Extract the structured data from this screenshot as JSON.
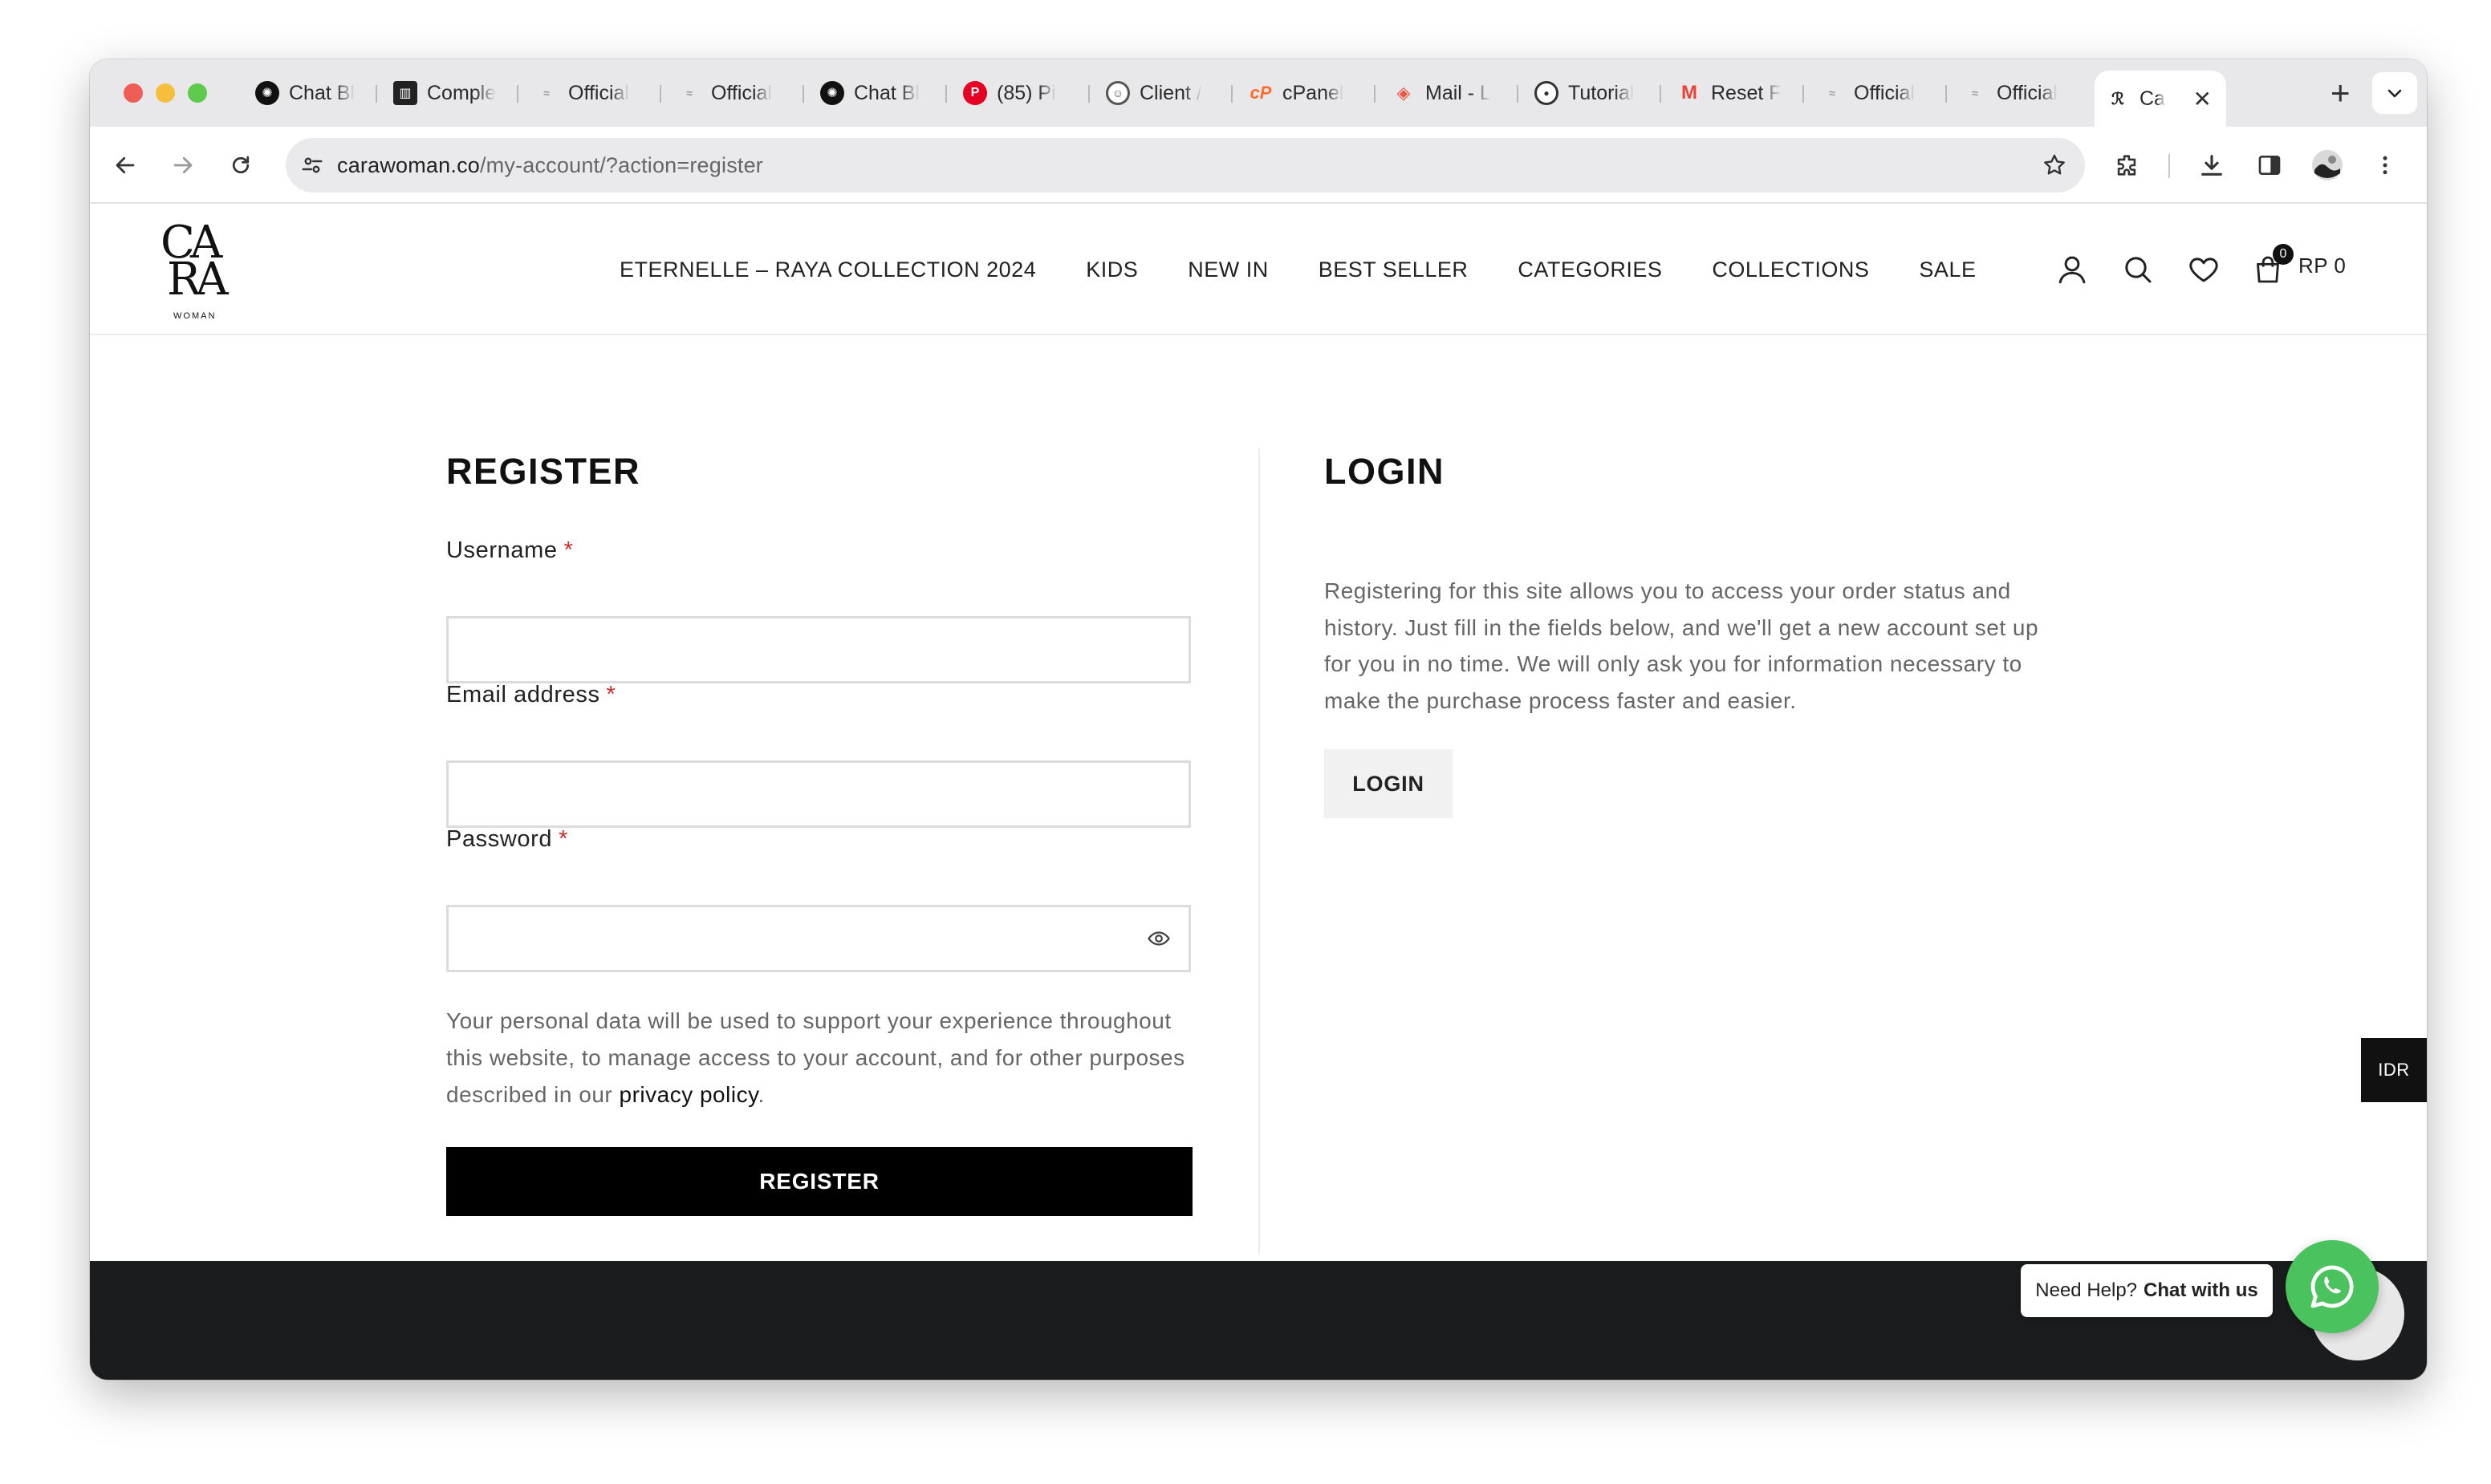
{
  "browser": {
    "tabs": [
      {
        "label": "Chat Bl",
        "favicon": "openai-icon",
        "color": "#111111"
      },
      {
        "label": "Comple",
        "favicon": "trello-icon",
        "color": "#222222"
      },
      {
        "label": "Official",
        "favicon": "site-icon",
        "color": "#9a9a9a"
      },
      {
        "label": "Official",
        "favicon": "site-icon",
        "color": "#9a9a9a"
      },
      {
        "label": "Chat Bl",
        "favicon": "openai-icon",
        "color": "#111111"
      },
      {
        "label": "(85) Pi",
        "favicon": "pinterest-icon",
        "color": "#e60023"
      },
      {
        "label": "Client /",
        "favicon": "client-icon",
        "color": "#555555"
      },
      {
        "label": "cPanel",
        "favicon": "cpanel-icon",
        "color": "#ff6c2c"
      },
      {
        "label": "Mail - L",
        "favicon": "laravel-icon",
        "color": "#f05340"
      },
      {
        "label": "Tutorial",
        "favicon": "tutorial-icon",
        "color": "#333333"
      },
      {
        "label": "Reset F",
        "favicon": "gmail-icon",
        "color": "#ea4335"
      },
      {
        "label": "Official",
        "favicon": "site-icon",
        "color": "#9a9a9a"
      },
      {
        "label": "Official",
        "favicon": "site-icon",
        "color": "#9a9a9a"
      }
    ],
    "active_tab": {
      "label": "Ca",
      "favicon": "cara-icon"
    },
    "url_host": "carawoman.co",
    "url_path": "/my-account/?action=register"
  },
  "site": {
    "logo": {
      "line1": "CA",
      "line2": "RA",
      "sub": "WOMAN"
    },
    "nav": [
      "ETERNELLE – RAYA COLLECTION 2024",
      "KIDS",
      "NEW IN",
      "BEST SELLER",
      "CATEGORIES",
      "COLLECTIONS",
      "SALE"
    ],
    "cart_count": "0",
    "cart_total": "RP 0"
  },
  "register": {
    "title": "REGISTER",
    "username_label": "Username",
    "email_label": "Email address",
    "password_label": "Password",
    "required_mark": "*",
    "username_value": "",
    "email_value": "",
    "password_value": "",
    "privacy_before": "Your personal data will be used to support your experience throughout this website, to manage access to your account, and for other purposes described in our ",
    "privacy_link": "privacy policy",
    "privacy_after": ".",
    "button": "REGISTER"
  },
  "login": {
    "title": "LOGIN",
    "text": "Registering for this site allows you to access your order status and history. Just fill in the fields below, and we'll get a new account set up for you in no time. We will only ask you for information necessary to make the purchase process faster and easier.",
    "button": "LOGIN"
  },
  "currency": "IDR",
  "help": {
    "text": "Need Help?",
    "cta": "Chat with us"
  },
  "colors": {
    "accent": "#000000",
    "whatsapp": "#4ac25e",
    "required": "#d12a2a",
    "footer": "#1b1c1e"
  }
}
